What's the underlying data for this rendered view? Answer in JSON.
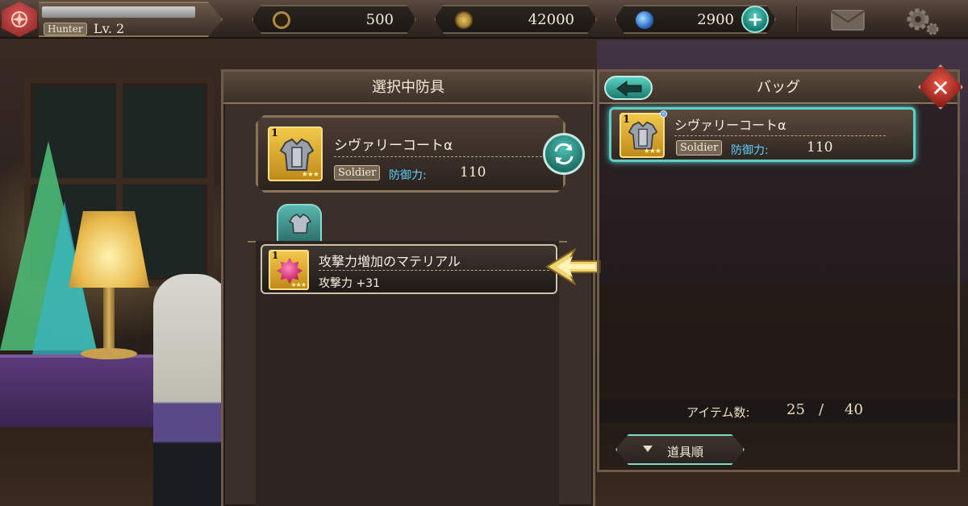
{
  "player": {
    "class_badge": "Hunter",
    "level": "Lv. 2"
  },
  "currencies": [
    {
      "name": "ring-currency",
      "value": "500"
    },
    {
      "name": "coin-currency",
      "value": "42000"
    },
    {
      "name": "gem-currency",
      "value": "2900"
    }
  ],
  "add_currency_label": "+",
  "icons": {
    "emblem": "player-emblem-icon",
    "mail": "mail-icon",
    "settings": "gear-icon",
    "swap": "swap-icon",
    "back": "back-arrow-icon",
    "close": "close-icon",
    "arrow": "insert-arrow-icon",
    "armor_tab": "armor-tab-icon"
  },
  "left_panel": {
    "title": "選択中防具",
    "equipped": {
      "count": "1",
      "name": "シヴァリーコートα",
      "class": "Soldier",
      "stat_label": "防御力:",
      "stat_value": "110",
      "rarity_stars": "★★★"
    },
    "materia": {
      "count": "1",
      "name": "攻撃力増加のマテリアル",
      "stat": "攻撃力 +31",
      "rarity_stars": "★★★"
    }
  },
  "right_panel": {
    "title": "バッグ",
    "close_label": "✕",
    "items": [
      {
        "count": "1",
        "name": "シヴァリーコートα",
        "class": "Soldier",
        "stat_label": "防御力:",
        "stat_value": "110",
        "rarity_stars": "★★★"
      }
    ],
    "item_count_label": "アイテム数:",
    "item_count_current": "25",
    "item_count_separator": "/",
    "item_count_max": "40",
    "sort_label": "道具順"
  },
  "colors": {
    "accent_teal": "#5ecfc6",
    "stat_blue": "#5bd0ff",
    "gold": "#f2c84a",
    "danger_red": "#e85a4a"
  }
}
